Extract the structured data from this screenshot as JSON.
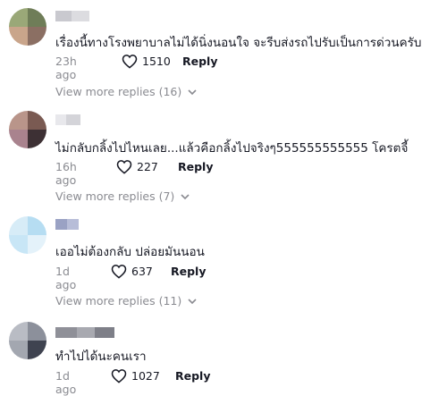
{
  "comments": [
    {
      "text": "เรื่องนี้ทางโรงพยาบาลไม่ได้นิ่งนอนใจ จะรีบส่งรถไปรับเป็นการด่วนครับ",
      "time": "23h ago",
      "likes": "1510",
      "reply_label": "Reply",
      "more_replies": "View more replies (16)"
    },
    {
      "text": "ไม่กลับกลิ้งไปไหนเลย...แล้วคือกลิ้งไปจริงๆ555555555555 โครตจี้",
      "time": "16h ago",
      "likes": "227",
      "reply_label": "Reply",
      "more_replies": "View more replies (7)"
    },
    {
      "text": "เออไม่ต้องกลับ ปล่อยมันนอน",
      "time": "1d ago",
      "likes": "637",
      "reply_label": "Reply",
      "more_replies": "View more replies (11)"
    },
    {
      "text": "ทำไปได้นะคนเรา",
      "time": "1d ago",
      "likes": "1027",
      "reply_label": "Reply"
    }
  ],
  "colors": {
    "text": "#161823",
    "secondary": "#8a8b91"
  },
  "icons": {
    "like": "heart-outline-icon",
    "expand": "chevron-down-icon"
  }
}
